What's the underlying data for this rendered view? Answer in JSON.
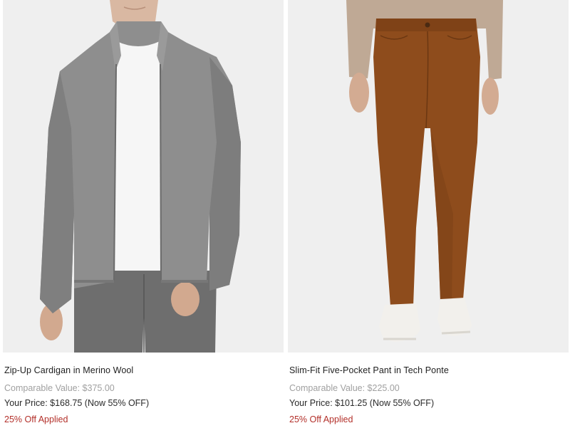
{
  "products": [
    {
      "name": "Zip-Up Cardigan in Merino Wool",
      "comparable": "Comparable Value: $375.00",
      "price": "Your Price: $168.75 (Now 55% OFF)",
      "promo": "25% Off Applied",
      "image_icon": "product-photo-cardigan"
    },
    {
      "name": "Slim-Fit Five-Pocket Pant in Tech Ponte",
      "comparable": "Comparable Value: $225.00",
      "price": "Your Price: $101.25 (Now 55% OFF)",
      "promo": "25% Off Applied",
      "image_icon": "product-photo-pant"
    }
  ],
  "colors": {
    "photo_bg": "#efefef",
    "promo_red": "#b3302a",
    "muted_gray": "#a0a0a0"
  }
}
